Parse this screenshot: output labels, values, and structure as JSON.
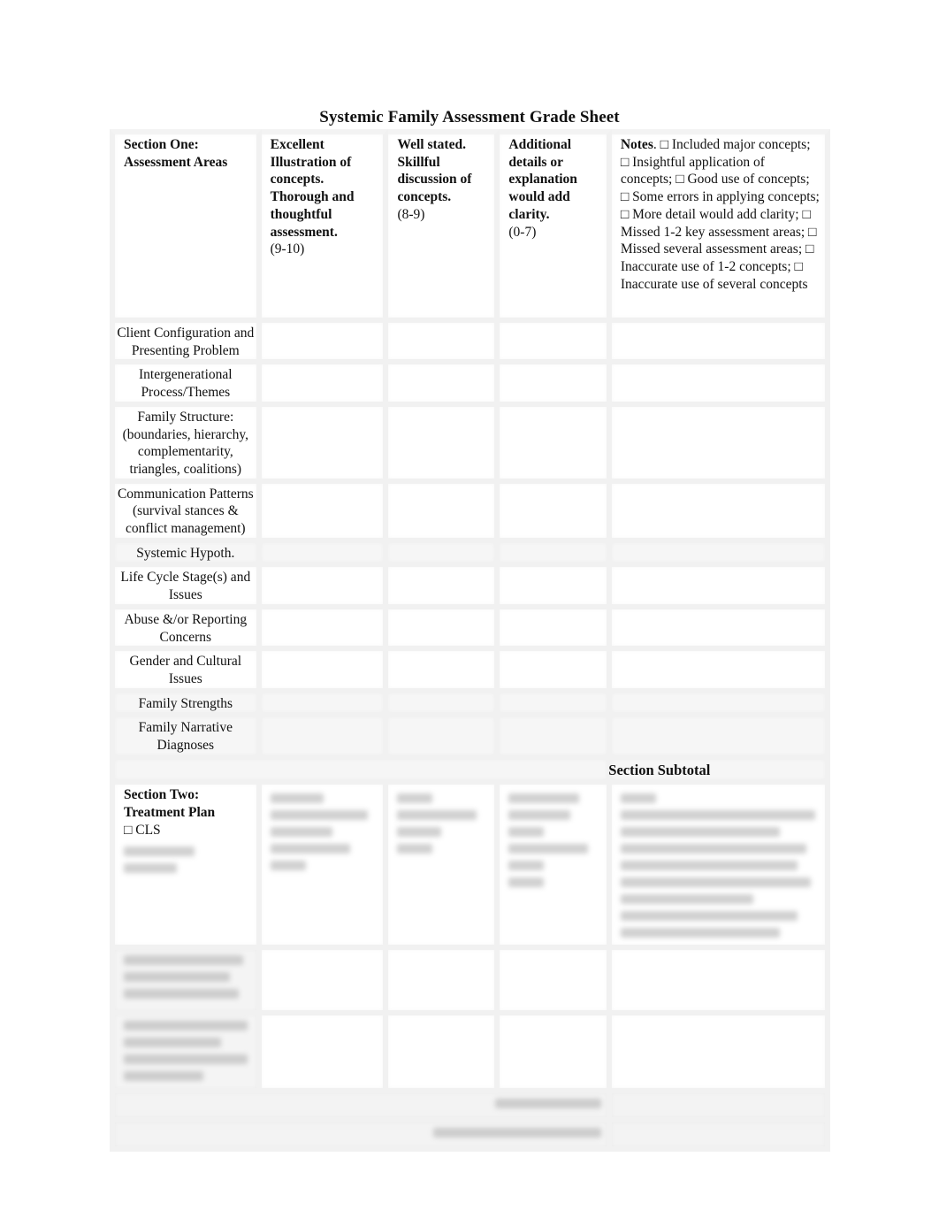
{
  "document": {
    "title": "Systemic Family Assessment Grade Sheet"
  },
  "section_one": {
    "header": {
      "col1": "Section One: Assessment Areas",
      "col2_bold": "Excellent Illustration of concepts. Thorough and thoughtful assessment.",
      "col2_range": "(9-10)",
      "col3_bold": "Well stated. Skillful discussion of concepts.",
      "col3_range": "(8-9)",
      "col4_bold": "Additional details or explanation would add clarity.",
      "col4_range": "(0-7)",
      "col5_bold": "Notes",
      "col5_text": ". □ Included major concepts; □ Insightful application of concepts; □ Good use of concepts; □ Some errors in applying concepts; □ More detail would add clarity; □ Missed 1-2 key assessment areas; □ Missed several assessment areas; □ Inaccurate use of 1-2 concepts; □ Inaccurate use of several concepts"
    },
    "rows": [
      {
        "area": "Client Configuration and Presenting Problem"
      },
      {
        "area": "Intergenerational Process/Themes"
      },
      {
        "area": "Family Structure: (boundaries, hierarchy, complementarity, triangles, coalitions)"
      },
      {
        "area": "Communication Patterns (survival stances & conflict management)"
      },
      {
        "area": "Systemic Hypoth."
      },
      {
        "area": "Life Cycle Stage(s) and Issues"
      },
      {
        "area": "Abuse &/or Reporting Concerns"
      },
      {
        "area": "Gender and Cultural Issues"
      },
      {
        "area": "Family Strengths"
      },
      {
        "area": "Family Narrative Diagnoses"
      }
    ],
    "subtotal_label": "Section Subtotal"
  },
  "section_two": {
    "header_line1": "Section Two:",
    "header_line2": "Treatment Plan",
    "checkbox_item": "□ CLS"
  }
}
